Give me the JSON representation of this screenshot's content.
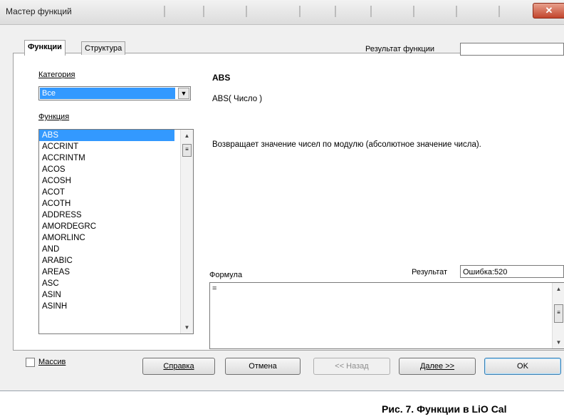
{
  "window": {
    "title": "Мастер функций",
    "close_glyph": "✕"
  },
  "tabs": [
    {
      "label": "Функции"
    },
    {
      "label": "Структура"
    }
  ],
  "category": {
    "label": "Категория",
    "value": "Все"
  },
  "function_list": {
    "label": "Функция",
    "items": [
      "ABS",
      "ACCRINT",
      "ACCRINTM",
      "ACOS",
      "ACOSH",
      "ACOT",
      "ACOTH",
      "ADDRESS",
      "AMORDEGRC",
      "AMORLINC",
      "AND",
      "ARABIC",
      "AREAS",
      "ASC",
      "ASIN",
      "ASINH"
    ],
    "selected": "ABS"
  },
  "function_result": {
    "label": "Результат функции",
    "value": ""
  },
  "function_info": {
    "name": "ABS",
    "syntax": "ABS( Число )",
    "description": "Возвращает значение чисел по модулю (абсолютное значение числа)."
  },
  "formula": {
    "label": "Формула",
    "value": "="
  },
  "result": {
    "label": "Результат",
    "value": "Ошибка:520"
  },
  "array": {
    "label": "Массив",
    "checked": false
  },
  "buttons": {
    "help": "Справка",
    "cancel": "Отмена",
    "back": "<< Назад",
    "next": "Далее >>",
    "ok": "OK"
  },
  "caption": "Рис. 7. Функции в LiO Cal"
}
